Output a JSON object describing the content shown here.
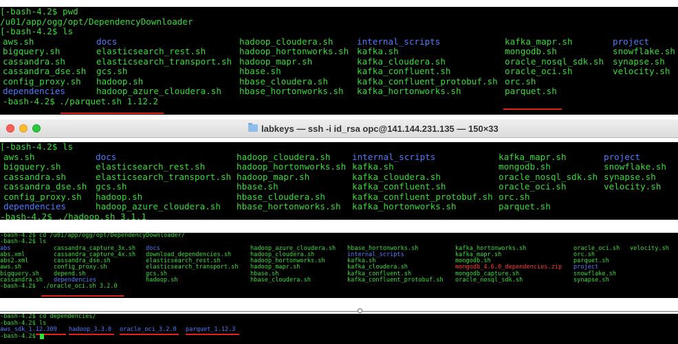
{
  "panel1": {
    "cmd_pwd": "[-bash-4.2$ pwd",
    "pwd_output": "/u01/app/ogg/opt/DependencyDownloader",
    "cmd_ls": "[-bash-4.2$ ls",
    "prompt": "-bash-4.2$",
    "command": "./parquet.sh 1.12.2",
    "ls_rows": [
      [
        "aws.sh",
        "docs",
        "hadoop_cloudera.sh",
        "internal_scripts",
        "kafka_mapr.sh",
        "project"
      ],
      [
        "bigquery.sh",
        "elasticsearch_rest.sh",
        "hadoop_hortonworks.sh",
        "kafka.sh",
        "mongodb.sh",
        "snowflake.sh"
      ],
      [
        "cassandra.sh",
        "elasticsearch_transport.sh",
        "hadoop_mapr.sh",
        "kafka_cloudera.sh",
        "oracle_nosql_sdk.sh",
        "synapse.sh"
      ],
      [
        "cassandra_dse.sh",
        "gcs.sh",
        "hbase.sh",
        "kafka_confluent.sh",
        "oracle_oci.sh",
        "velocity.sh"
      ],
      [
        "config_proxy.sh",
        "hadoop.sh",
        "hbase_cloudera.sh",
        "kafka_confluent_protobuf.sh",
        "orc.sh",
        ""
      ],
      [
        "dependencies",
        "hadoop_azure_cloudera.sh",
        "hbase_hortonworks.sh",
        "kafka_hortonworks.sh",
        "parquet.sh",
        ""
      ]
    ]
  },
  "window": {
    "title": "labkeys — ssh -i id_rsa opc@141.144.231.135 — 150×33",
    "folder_icon": "folder-icon"
  },
  "panel2": {
    "cmd_ls": "[-bash-4.2$ ls",
    "prompt": "-bash-4.2$",
    "command": "./hadoop.sh 3.1.1",
    "ls_rows": [
      [
        "aws.sh",
        "docs",
        "hadoop_cloudera.sh",
        "internal_scripts",
        "kafka_mapr.sh",
        "project"
      ],
      [
        "bigquery.sh",
        "elasticsearch_rest.sh",
        "hadoop_hortonworks.sh",
        "kafka.sh",
        "mongodb.sh",
        "snowflake.sh"
      ],
      [
        "cassandra.sh",
        "elasticsearch_transport.sh",
        "hadoop_mapr.sh",
        "kafka_cloudera.sh",
        "oracle_nosql_sdk.sh",
        "synapse.sh"
      ],
      [
        "cassandra_dse.sh",
        "gcs.sh",
        "hbase.sh",
        "kafka_confluent.sh",
        "oracle_oci.sh",
        "velocity.sh"
      ],
      [
        "config_proxy.sh",
        "hadoop.sh",
        "hbase_cloudera.sh",
        "kafka_confluent_protobuf.sh",
        "orc.sh",
        ""
      ],
      [
        "dependencies",
        "hadoop_azure_cloudera.sh",
        "hbase_hortonworks.sh",
        "kafka_hortonworks.sh",
        "parquet.sh",
        ""
      ]
    ]
  },
  "panel3": {
    "cmd_cd": "-bash-4.2$ cd /u01/app/ogg/opt/DependencyDownloader/",
    "cmd_ls": "-bash-4.2$ ls",
    "prompt": "-bash-4.2$",
    "command": "./oracle_oci.sh 3.2.0",
    "ls_rows": [
      [
        "abs",
        "cassandra_capture_3x.sh",
        "docs",
        "hadoop_azure_cloudera.sh",
        "hbase_hortonworks.sh",
        "kafka_hortonworks.sh",
        "oracle_oci.sh",
        "velocity.sh"
      ],
      [
        "abs.xml",
        "cassandra_capture_4x.sh",
        "download_dependencies.sh",
        "hadoop_cloudera.sh",
        "internal_scripts",
        "kafka_mapr.sh",
        "orc.sh",
        ""
      ],
      [
        "abs2.xml",
        "cassandra_dse.sh",
        "elasticsearch_rest.sh",
        "hadoop_hortonworks.sh",
        "kafka.sh",
        "mongodb.sh",
        "parquet.sh",
        ""
      ],
      [
        "aws.sh",
        "config_proxy.sh",
        "elasticsearch_transport.sh",
        "hadoop_mapr.sh",
        "kafka_cloudera.sh",
        "mongodb_4.6.0_dependencies.zip",
        "project",
        ""
      ],
      [
        "bigquery.sh",
        "depend.sh",
        "gcs.sh",
        "hbase.sh",
        "kafka_confluent.sh",
        "mongodb_capture.sh",
        "snowflake.sh",
        ""
      ],
      [
        "cassandra.sh",
        "dependencies",
        "hadoop.sh",
        "hbase_cloudera.sh",
        "kafka_confluent_protobuf.sh",
        "oracle_nosql_sdk.sh",
        "synapse.sh",
        ""
      ]
    ]
  },
  "panel4": {
    "cmd_cd": "-bash-4.2$ cd dependencies/",
    "cmd_ls": "-bash-4.2$ ls",
    "dirs": [
      "aws_sdk_1.12.309",
      "hadoop_3.3.0",
      "oracle_oci_3.2.0",
      "parquet_1.12.3"
    ],
    "prompt": "-bash-4.2$"
  }
}
